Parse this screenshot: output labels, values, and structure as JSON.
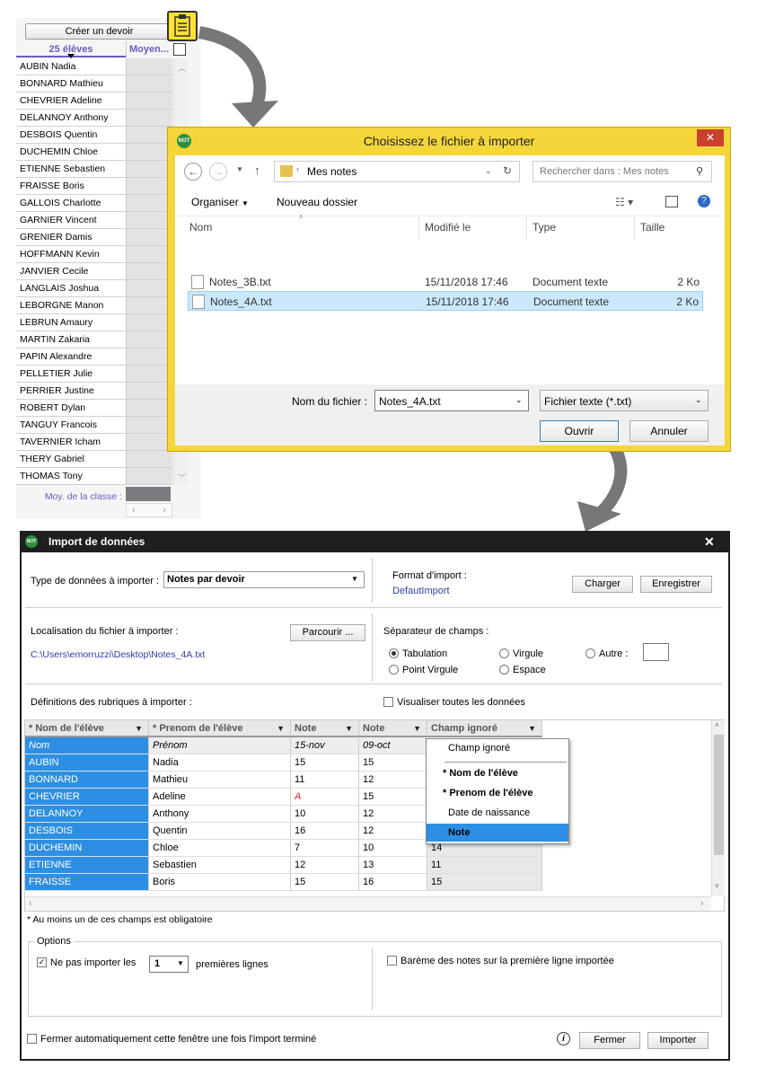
{
  "student_panel": {
    "create_button": "Créer un devoir",
    "count_header": "25 élèves",
    "avg_header": "Moyen...",
    "students": [
      "AUBIN Nadia",
      "BONNARD Mathieu",
      "CHEVRIER Adeline",
      "DELANNOY Anthony",
      "DESBOIS Quentin",
      "DUCHEMIN Chloe",
      "ETIENNE Sebastien",
      "FRAISSE Boris",
      "GALLOIS Charlotte",
      "GARNIER Vincent",
      "GRENIER Damis",
      "HOFFMANN Kevin",
      "JANVIER Cecile",
      "LANGLAIS Joshua",
      "LEBORGNE Manon",
      "LEBRUN Amaury",
      "MARTIN Zakaria",
      "PAPIN Alexandre",
      "PELLETIER Julie",
      "PERRIER Justine",
      "ROBERT Dylan",
      "TANGUY Francois",
      "TAVERNIER Icham",
      "THERY Gabriel",
      "THOMAS Tony"
    ],
    "class_avg_label": "Moy. de la classe :"
  },
  "file_dialog": {
    "title": "Choisissez le fichier à importer",
    "logo": "NOT",
    "address": "Mes notes",
    "search_placeholder": "Rechercher dans : Mes notes",
    "organize": "Organiser",
    "new_folder": "Nouveau dossier",
    "columns": [
      "Nom",
      "Modifié le",
      "Type",
      "Taille"
    ],
    "files": [
      {
        "name": "Notes_3B.txt",
        "modified": "15/11/2018 17:46",
        "type": "Document texte",
        "size": "2 Ko"
      },
      {
        "name": "Notes_4A.txt",
        "modified": "15/11/2018 17:46",
        "type": "Document texte",
        "size": "2 Ko"
      }
    ],
    "filename_label": "Nom du fichier :",
    "filename_value": "Notes_4A.txt",
    "filetype_value": "Fichier texte (*.txt)",
    "open_button": "Ouvrir",
    "cancel_button": "Annuler"
  },
  "import_dialog": {
    "title": "Import de données",
    "logo": "NOT",
    "close": "✕",
    "data_type_label": "Type de données à importer :",
    "data_type_value": "Notes par devoir",
    "format_label": "Format d'import :",
    "format_value": "DefautImport",
    "load_button": "Charger",
    "save_button": "Enregistrer",
    "location_label": "Localisation du fichier à importer :",
    "browse_button": "Parcourir ...",
    "path": "C:\\Users\\emorruzzi\\Desktop\\Notes_4A.txt",
    "separator_label": "Séparateur de champs :",
    "separators": {
      "tab": "Tabulation",
      "comma": "Virgule",
      "other": "Autre :",
      "semicolon": "Point Virgule",
      "space": "Espace"
    },
    "definitions_label": "Définitions des rubriques à importer :",
    "show_all_label": "Visualiser toutes les données",
    "grid_headers": [
      "* Nom de l'élève",
      "* Prenom de l'élève",
      "Note",
      "Note",
      "Champ ignoré"
    ],
    "grid_first_row": [
      "Nom",
      "Prénom",
      "15-nov",
      "09-oct",
      ""
    ],
    "grid_rows": [
      [
        "AUBIN",
        "Nadia",
        "15",
        "15",
        ""
      ],
      [
        "BONNARD",
        "Mathieu",
        "11",
        "12",
        ""
      ],
      [
        "CHEVRIER",
        "Adeline",
        "A",
        "15",
        ""
      ],
      [
        "DELANNOY",
        "Anthony",
        "10",
        "12",
        ""
      ],
      [
        "DESBOIS",
        "Quentin",
        "16",
        "12",
        ""
      ],
      [
        "DUCHEMIN",
        "Chloe",
        "7",
        "10",
        "14"
      ],
      [
        "ETIENNE",
        "Sebastien",
        "12",
        "13",
        "11"
      ],
      [
        "FRAISSE",
        "Boris",
        "15",
        "16",
        "15"
      ]
    ],
    "dropdown_items": [
      "Champ ignoré",
      "* Nom de l'élève",
      "* Prenom de l'élève",
      "Date de naissance",
      "Note"
    ],
    "required_note": "* Au moins un de ces champs est obligatoire",
    "options_label": "Options",
    "skip_label": "Ne pas importer les",
    "skip_value": "1",
    "skip_suffix": "premières lignes",
    "scale_label": "Barème des notes sur la première ligne importée",
    "auto_close_label": "Fermer automatiquement cette fenêtre une fois l'import terminé",
    "close_button": "Fermer",
    "import_button": "Importer"
  }
}
